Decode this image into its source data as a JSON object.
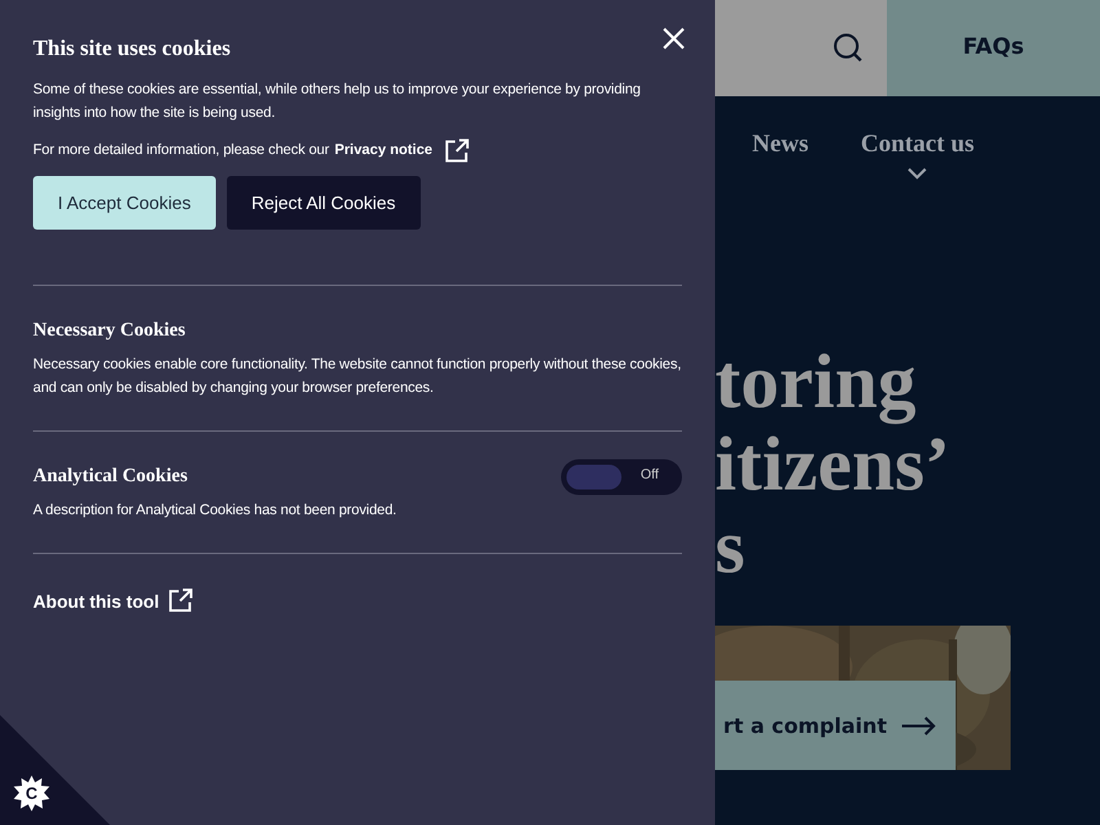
{
  "background_page": {
    "faqs_link": "FAQs",
    "nav": [
      {
        "label": "News",
        "has_dropdown": false
      },
      {
        "label": "Contact us",
        "has_dropdown": true
      }
    ],
    "hero_lines": [
      "toring",
      "itizens’",
      "s"
    ],
    "complaint_button": "rt a complaint"
  },
  "cookie_panel": {
    "title": "This site uses cookies",
    "intro": "Some of these cookies are essential, while others help us to improve your experience by providing insights into how the site is being used.",
    "privacy_text": "For more detailed information, please check our",
    "privacy_link": "Privacy notice",
    "buttons": [
      {
        "label": "I Accept Cookies",
        "kind": "primary"
      },
      {
        "label": "Reject All Cookies",
        "kind": "secondary"
      }
    ],
    "sections": [
      {
        "title": "Necessary Cookies",
        "description": "Necessary cookies enable core functionality. The website cannot function properly without these cookies, and can only be disabled by changing your browser preferences."
      },
      {
        "title": "Analytical Cookies",
        "description": "A description for Analytical Cookies has not been provided.",
        "toggle": {
          "on": false,
          "label": "Off"
        }
      }
    ],
    "about_link": "About this tool"
  },
  "cookie_badge": {
    "letter": "C"
  }
}
